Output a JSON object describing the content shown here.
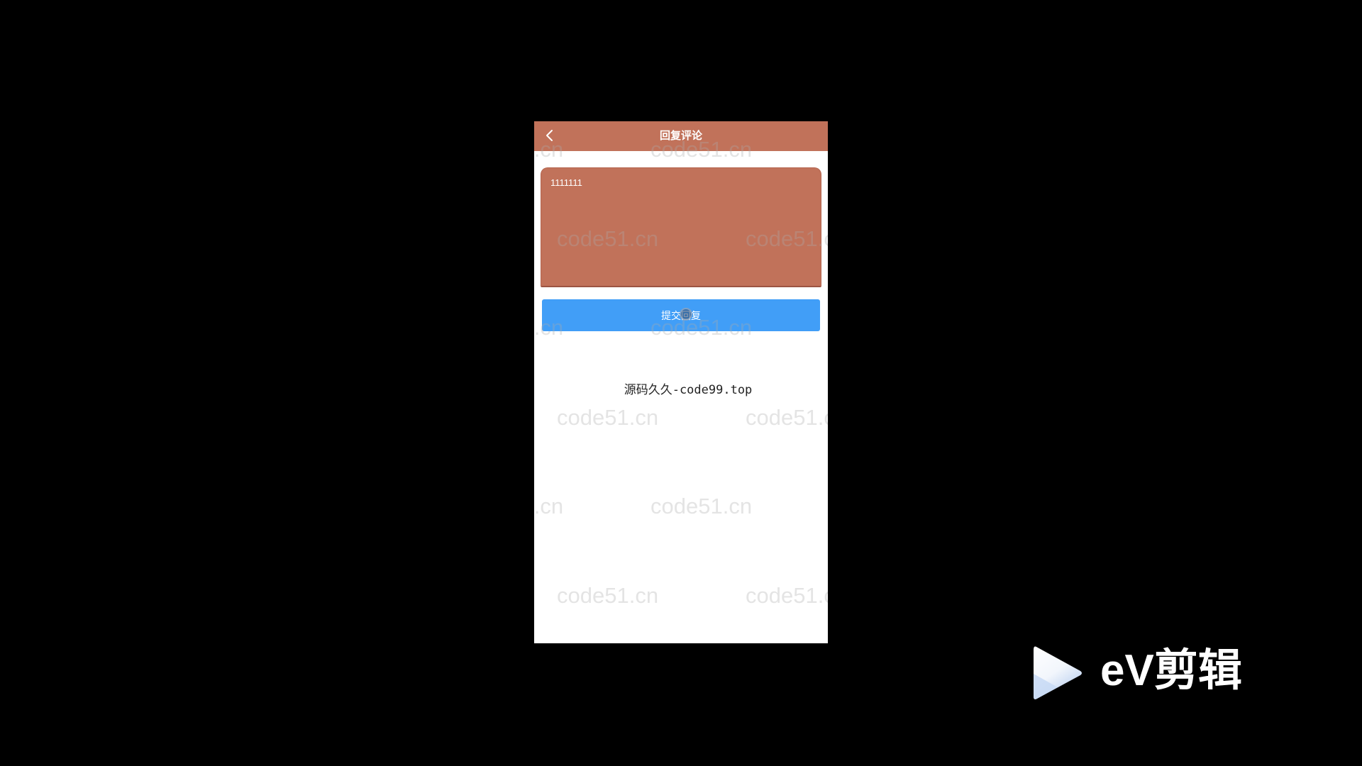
{
  "phone": {
    "header": {
      "title": "回复评论",
      "back_icon": "chevron-left-icon",
      "background": "#c1725a"
    },
    "reply_field": {
      "value": "1111111",
      "background": "#c1725a"
    },
    "submit_button": {
      "label": "提交回复",
      "background": "#419ef7"
    },
    "footer_text": "源码久久-code99.top",
    "watermark_text": "code51.cn"
  },
  "logo": {
    "icon": "play-icon",
    "text": "eV剪辑"
  },
  "colors": {
    "page_background": "#000000",
    "content_background": "#ffffff"
  }
}
